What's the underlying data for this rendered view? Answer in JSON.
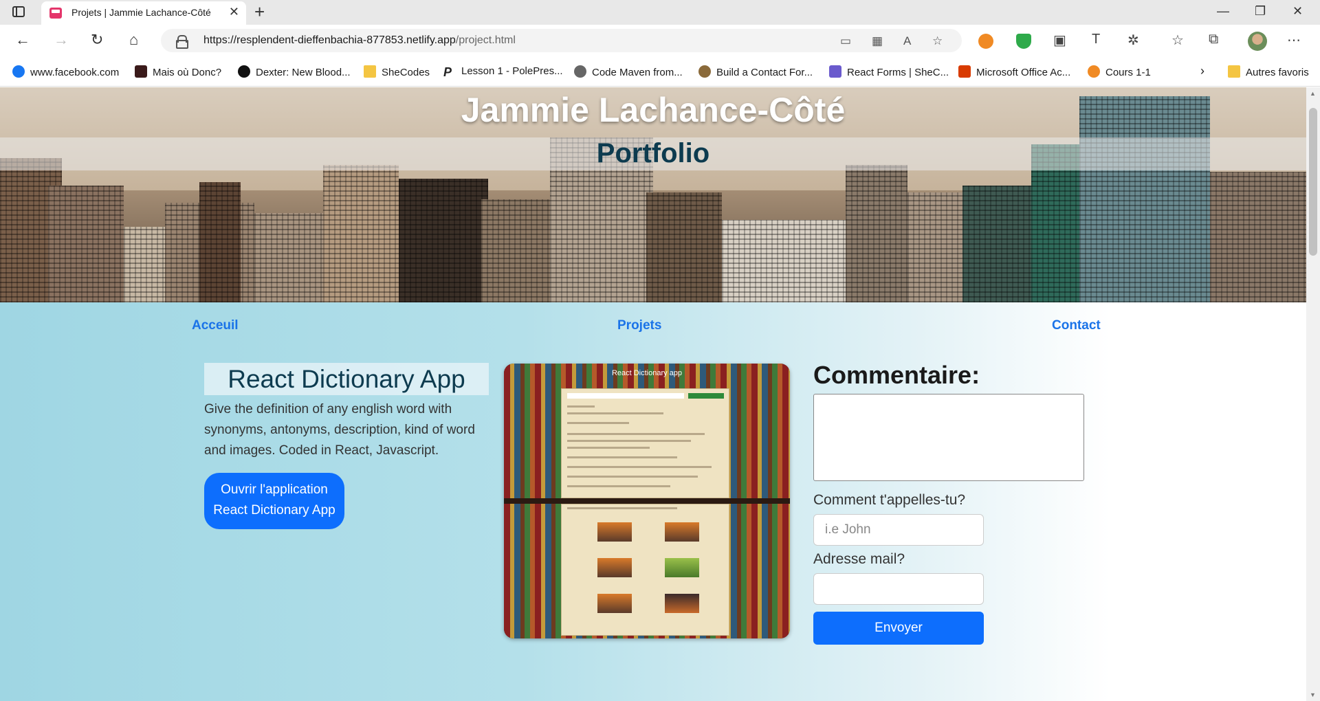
{
  "browser": {
    "tab_title": "Projets | Jammie Lachance-Côté",
    "url_host": "https://resplendent-dieffenbachia-877853.netlify.app",
    "url_path": "/project.html",
    "bookmarks": [
      {
        "label": "www.facebook.com",
        "icon": "facebook-icon",
        "color": "#1877f2"
      },
      {
        "label": "Mais où Donc?",
        "icon": "maisoudonc-icon",
        "color": "#3a1a1a"
      },
      {
        "label": "Dexter: New Blood...",
        "icon": "showtime-icon",
        "color": "#111111"
      },
      {
        "label": "SheCodes",
        "icon": "folder-icon",
        "color": "#f4c542"
      },
      {
        "label": "Lesson 1 - PolePres...",
        "icon": "letter-p-icon",
        "color": "#222222"
      },
      {
        "label": "Code Maven from...",
        "icon": "code-maven-icon",
        "color": "#444444"
      },
      {
        "label": "Build a Contact For...",
        "icon": "build-contact-icon",
        "color": "#8a6a3a"
      },
      {
        "label": "React Forms | SheC...",
        "icon": "shecodes-icon",
        "color": "#6a5acd"
      },
      {
        "label": "Microsoft Office Ac...",
        "icon": "office-icon",
        "color": "#d83b01"
      },
      {
        "label": "Cours 1-1",
        "icon": "flower-icon",
        "color": "#f08a24"
      }
    ],
    "other_favorites": "Autres favoris"
  },
  "hero": {
    "name": "Jammie Lachance-Côté",
    "subtitle": "Portfolio"
  },
  "nav": {
    "home": "Acceuil",
    "projects": "Projets",
    "contact": "Contact"
  },
  "project": {
    "title": "React Dictionary App",
    "description": "Give the definition of any english word with synonyms, antonyms, description, kind of word and images. Coded in React, Javascript.",
    "button_line1": "Ouvrir l'application",
    "button_line2": "React Dictionary App",
    "screenshot_title": "React Dictionary app"
  },
  "form": {
    "comment_label": "Commentaire:",
    "name_label": "Comment t'appelles-tu?",
    "name_placeholder": "i.e John",
    "email_label": "Adresse mail?",
    "submit": "Envoyer"
  },
  "colors": {
    "accent": "#0d6efd",
    "link": "#1a73e8",
    "title_dark": "#0d3b4f"
  }
}
